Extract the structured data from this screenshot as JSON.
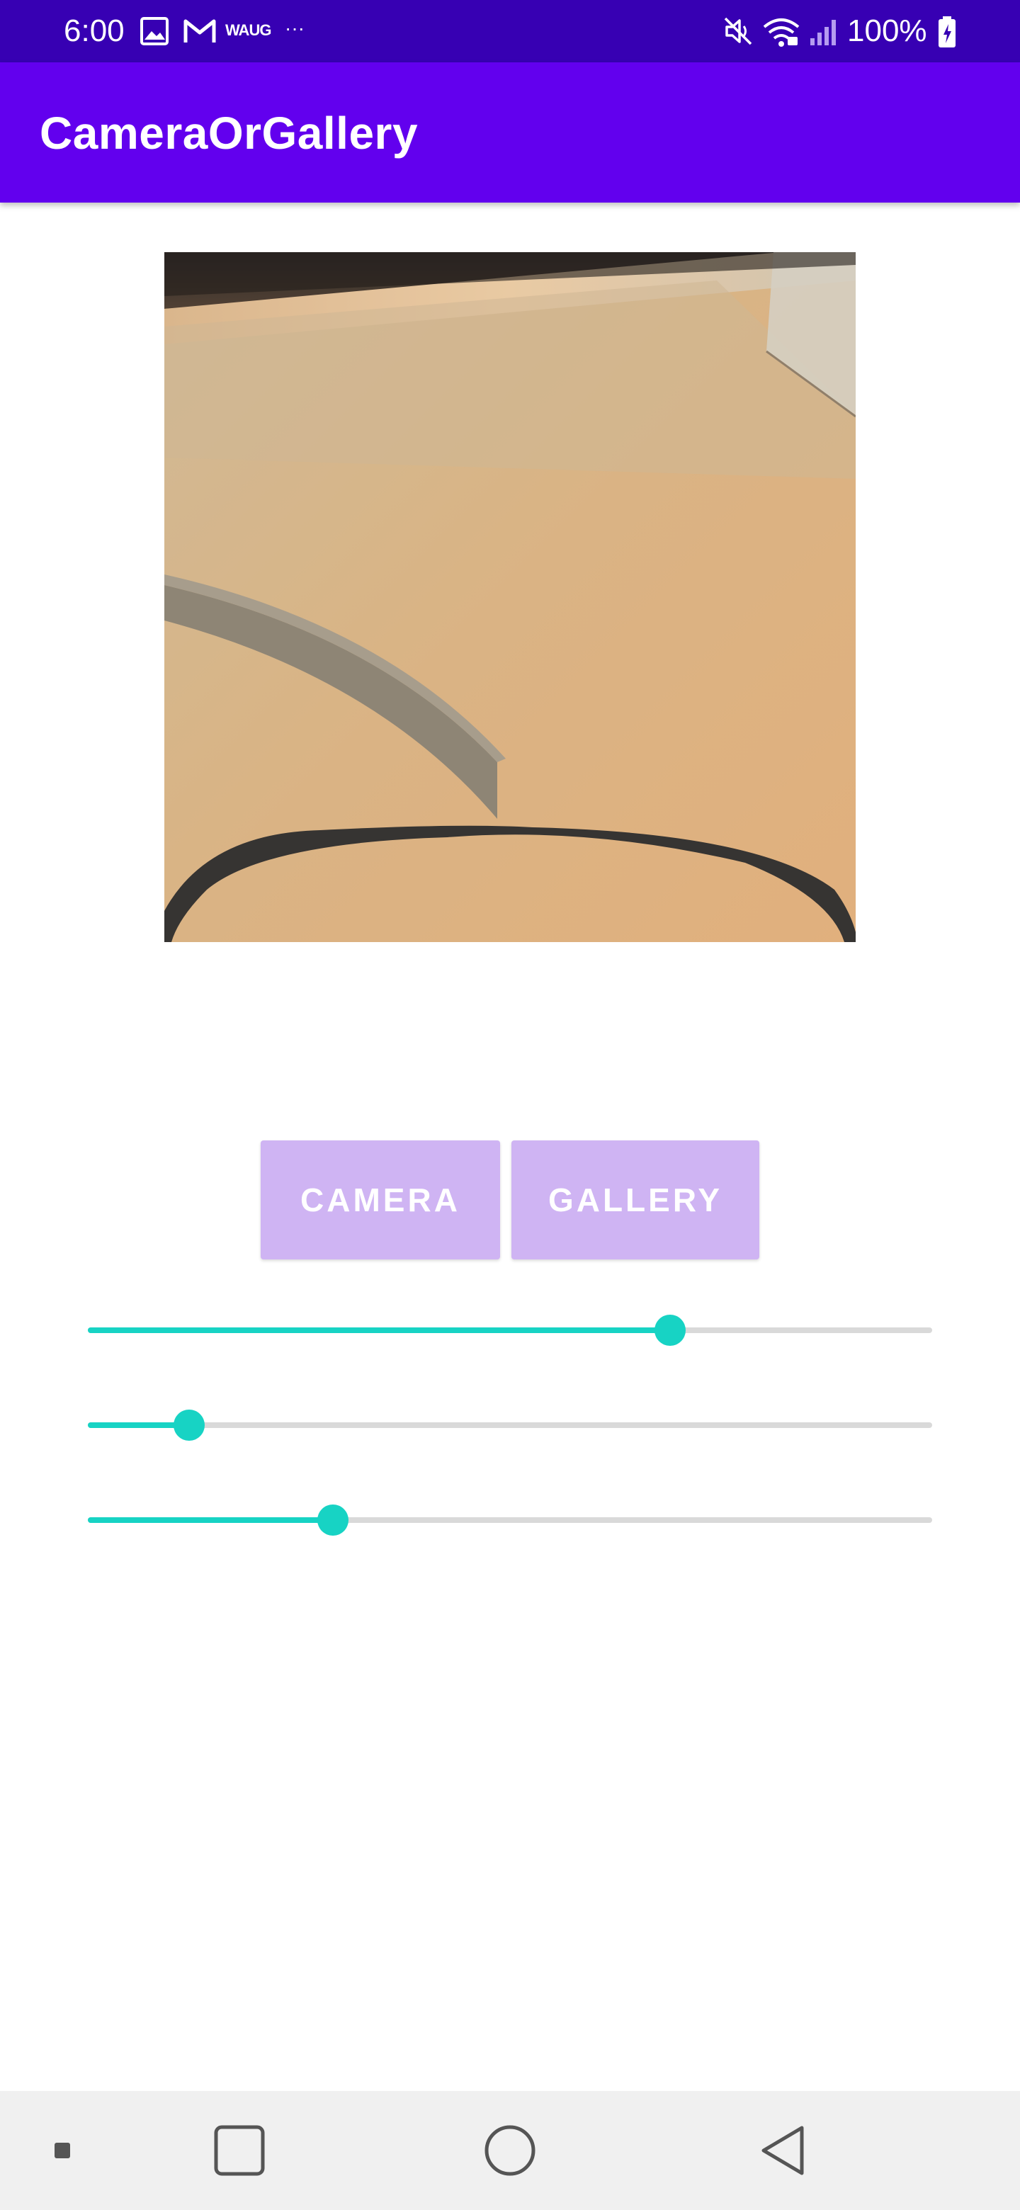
{
  "status_bar": {
    "time": "6:00",
    "notification_text": "WAUG",
    "more": "···",
    "battery": "100%",
    "icons": [
      "image-icon",
      "gmail-icon",
      "mute-icon",
      "wifi-icon",
      "signal-icon",
      "battery-charging-icon"
    ]
  },
  "app_bar": {
    "title": "CameraOrGallery",
    "color": "#6200ee"
  },
  "buttons": {
    "camera": "CAMERA",
    "gallery": "GALLERY",
    "color": "#cfb4f3"
  },
  "sliders": [
    {
      "value": 0.69
    },
    {
      "value": 0.12
    },
    {
      "value": 0.29
    }
  ],
  "accent_color": "#17d3c4",
  "nav_bar": {
    "icons": [
      "recent-dot-icon",
      "overview-square-icon",
      "home-circle-icon",
      "back-triangle-icon"
    ]
  }
}
